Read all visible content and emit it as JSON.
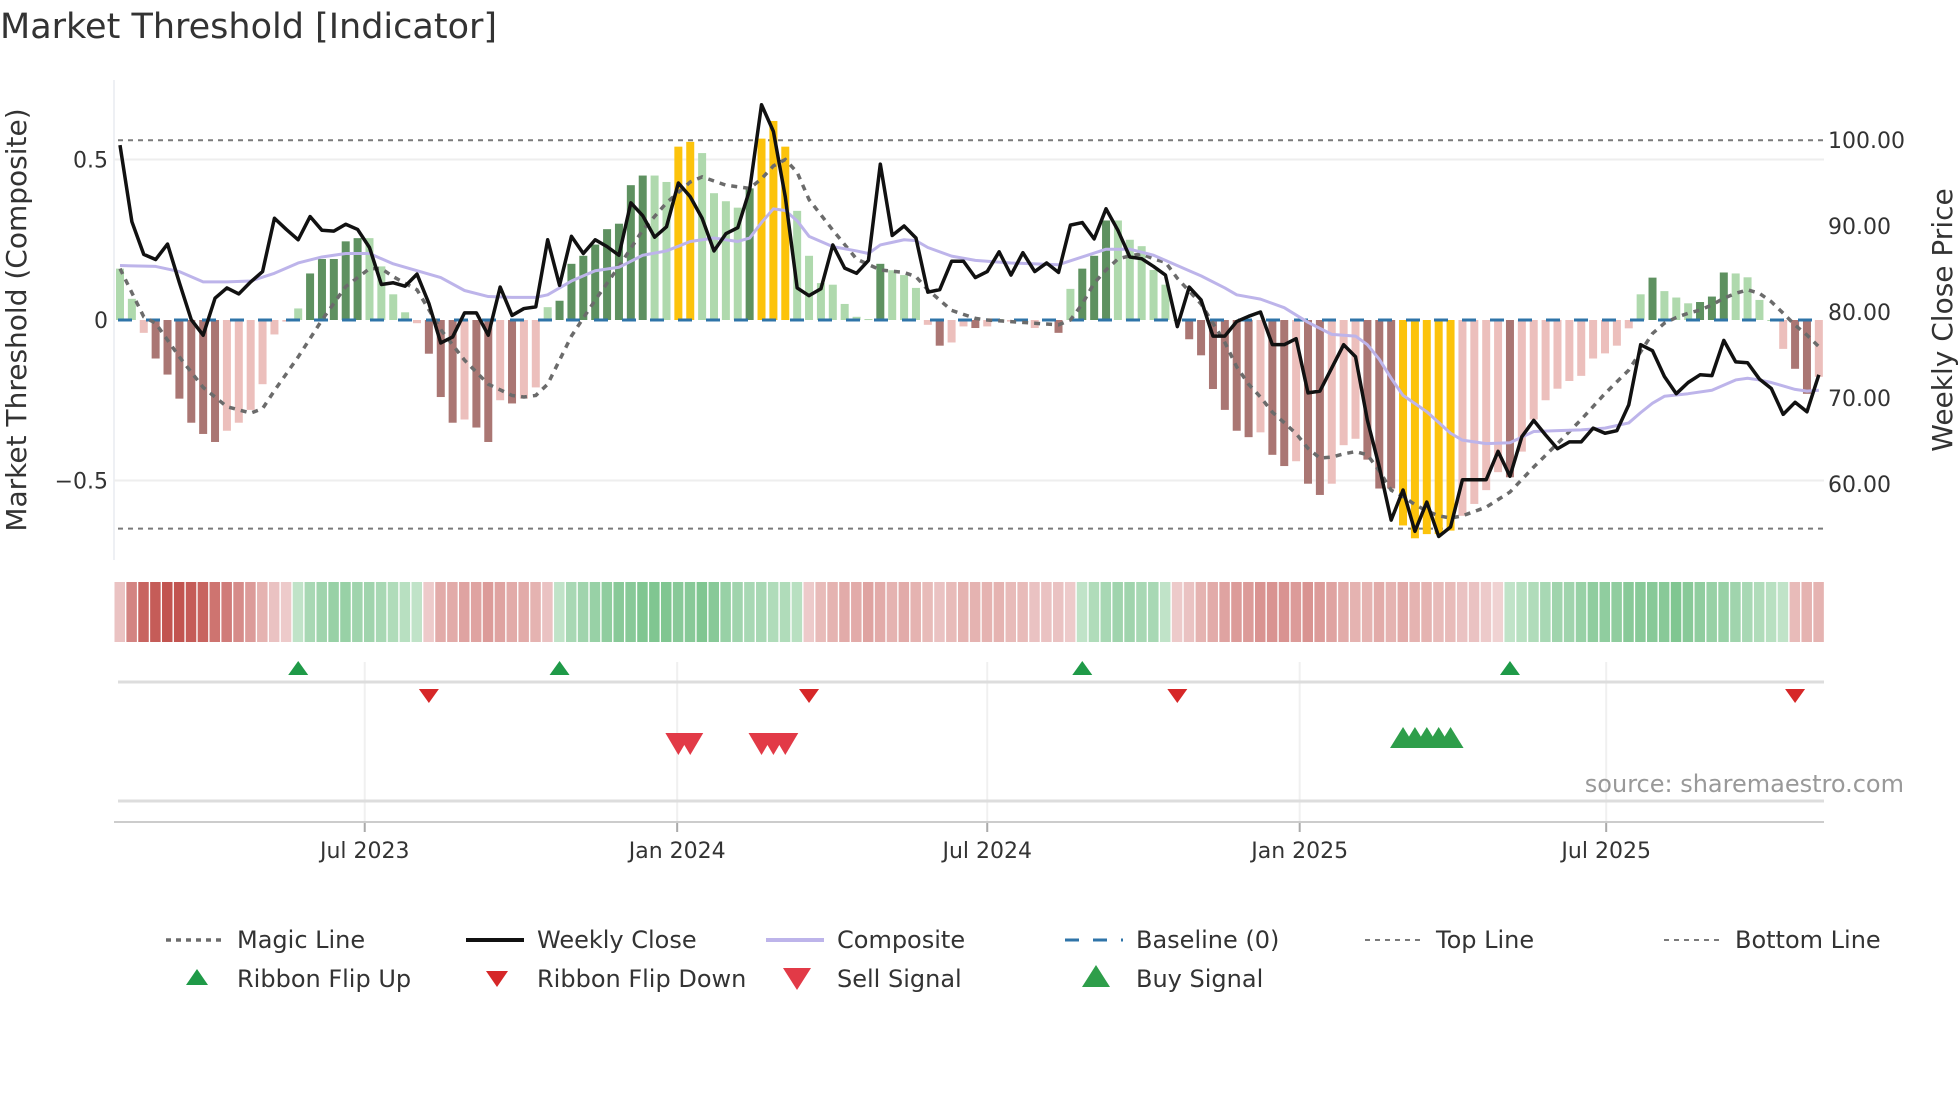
{
  "title": "Market Threshold [Indicator]",
  "source": "source: sharemaestro.com",
  "colors": {
    "bar_pos_dark": "#5e9160",
    "bar_pos_light": "#afd9ad",
    "bar_neg_dark": "#aa7673",
    "bar_neg_light": "#ecbfbc",
    "bar_signal": "#fcc30b",
    "weekly_close": "#111111",
    "composite": "#bdb4ea",
    "magic": "#6b6b6b",
    "baseline": "#2f74a8",
    "threshold": "#7a7a7a",
    "flip_up": "#1f9a48",
    "flip_down": "#d62728",
    "sell": "#e23a47",
    "buy": "#2e9e4a"
  },
  "chart_data": {
    "type": "bar+line",
    "title": "Market Threshold [Indicator]",
    "ylabel_left": "Market Threshold (Composite)",
    "ylabel_right": "Weekly Close Price",
    "ylim_left": [
      -0.75,
      0.7
    ],
    "ylim_right": [
      54,
      104
    ],
    "left_ticks": [
      {
        "label": "0.5",
        "value": 0.5
      },
      {
        "label": "0",
        "value": 0
      },
      {
        "label": "−0.5",
        "value": -0.5
      }
    ],
    "right_ticks": [
      {
        "label": "100.00",
        "value": 100
      },
      {
        "label": "90.00",
        "value": 90
      },
      {
        "label": "80.00",
        "value": 80
      },
      {
        "label": "70.00",
        "value": 70
      },
      {
        "label": "60.00",
        "value": 60
      }
    ],
    "x_ticks": [
      {
        "label": "Jul 2023",
        "week_index": 20.6
      },
      {
        "label": "Jan 2024",
        "week_index": 46.9
      },
      {
        "label": "Jul 2024",
        "week_index": 73
      },
      {
        "label": "Jan 2025",
        "week_index": 99.3
      },
      {
        "label": "Jul 2025",
        "week_index": 125.1
      }
    ],
    "top_line": 0.56,
    "bottom_line": -0.65,
    "baseline": 0,
    "composite_bars": [
      0.16,
      0.066,
      -0.04,
      -0.12,
      -0.17,
      -0.245,
      -0.32,
      -0.355,
      -0.38,
      -0.345,
      -0.32,
      -0.28,
      -0.2,
      -0.045,
      -0.005,
      0.036,
      0.145,
      0.19,
      0.19,
      0.245,
      0.255,
      0.255,
      0.167,
      0.08,
      0.024,
      -0.01,
      -0.105,
      -0.24,
      -0.32,
      -0.31,
      -0.335,
      -0.38,
      -0.25,
      -0.26,
      -0.245,
      -0.21,
      0.04,
      0.06,
      0.175,
      0.2,
      0.235,
      0.283,
      0.3,
      0.42,
      0.45,
      0.45,
      0.43,
      0.54,
      0.555,
      0.52,
      0.395,
      0.37,
      0.35,
      0.41,
      0.565,
      0.62,
      0.54,
      0.34,
      0.2,
      0.115,
      0.11,
      0.05,
      0.01,
      0.003,
      0.175,
      0.155,
      0.14,
      0.1,
      -0.015,
      -0.08,
      -0.07,
      -0.02,
      -0.025,
      -0.02,
      0.003,
      -0.005,
      0,
      -0.025,
      0,
      -0.04,
      0.097,
      0.16,
      0.2,
      0.31,
      0.31,
      0.25,
      0.23,
      0.156,
      0.11,
      0,
      -0.06,
      -0.11,
      -0.215,
      -0.28,
      -0.345,
      -0.365,
      -0.35,
      -0.42,
      -0.455,
      -0.44,
      -0.51,
      -0.545,
      -0.51,
      -0.39,
      -0.37,
      -0.435,
      -0.525,
      -0.525,
      -0.64,
      -0.68,
      -0.667,
      -0.667,
      -0.656,
      -0.61,
      -0.573,
      -0.53,
      -0.474,
      -0.49,
      -0.41,
      -0.31,
      -0.25,
      -0.214,
      -0.19,
      -0.174,
      -0.12,
      -0.104,
      -0.08,
      -0.026,
      0.08,
      0.132,
      0.09,
      0.07,
      0.052,
      0.056,
      0.073,
      0.148,
      0.145,
      0.133,
      0.0625,
      0,
      -0.09,
      -0.152,
      -0.23,
      -0.177
    ],
    "bar_shades": "LLLDDDDDDLLLLLLLDDDDDLLLLLDDDLDDLDLLLDDDDDDDDLLYYLLLLDYYYLLLLLLLDLLLLDLLDLLLLLLDLDDDLLLLLLDDDDDDLDDLDDLLLDDDYYYYYLLLLDLLLLLLLLLLLDLLLDDDLLLLLDDL",
    "weekly_close": [
      99.4,
      90.5,
      86.7,
      86.1,
      87.9,
      83.4,
      79.1,
      77.3,
      81.6,
      82.8,
      82.1,
      83.5,
      84.7,
      90.9,
      89.6,
      88.4,
      91.1,
      89.5,
      89.4,
      90.2,
      89.6,
      87.5,
      83.2,
      83.4,
      83.0,
      84.4,
      81.0,
      76.4,
      77.1,
      79.9,
      79.9,
      77.3,
      82.9,
      79.6,
      80.4,
      80.6,
      88.4,
      83.1,
      88.8,
      86.8,
      88.4,
      87.6,
      86.6,
      92.7,
      91.2,
      88.7,
      89.9,
      95.0,
      93.4,
      90.9,
      87.1,
      89.1,
      89.8,
      94.2,
      104.1,
      101.0,
      93.4,
      82.8,
      81.9,
      82.7,
      87.8,
      85.1,
      84.5,
      86.0,
      97.2,
      88.9,
      90.0,
      88.6,
      82.3,
      82.6,
      85.9,
      85.9,
      84.0,
      84.7,
      87.0,
      84.3,
      86.9,
      84.7,
      85.7,
      84.6,
      90.1,
      90.4,
      88.5,
      92.0,
      89.5,
      86.4,
      86.2,
      85.3,
      84.3,
      78.3,
      82.9,
      81.4,
      77.2,
      77.2,
      78.9,
      79.5,
      80.0,
      76.2,
      76.2,
      76.9,
      70.6,
      70.8,
      73.5,
      76.2,
      74.8,
      67.4,
      62.0,
      55.8,
      59.3,
      54.5,
      57.9,
      53.9,
      55.0,
      60.5,
      60.5,
      60.5,
      63.8,
      60.9,
      65.5,
      67.4,
      65.7,
      64.1,
      64.9,
      64.9,
      66.5,
      65.9,
      66.2,
      69.2,
      76.2,
      75.5,
      72.5,
      70.5,
      71.8,
      72.7,
      72.6,
      76.7,
      74.2,
      74.1,
      72.2,
      71.1,
      68.1,
      69.5,
      68.4,
      72.7
    ],
    "composite_line": [
      [
        0,
        85.4
      ],
      [
        3,
        85.3
      ],
      [
        5,
        84.7
      ],
      [
        7,
        83.5
      ],
      [
        9,
        83.5
      ],
      [
        11,
        83.6
      ],
      [
        13,
        84.5
      ],
      [
        15,
        85.7
      ],
      [
        17,
        86.4
      ],
      [
        19,
        86.8
      ],
      [
        21,
        86.8
      ],
      [
        23,
        85.6
      ],
      [
        25,
        84.8
      ],
      [
        27,
        84.0
      ],
      [
        29,
        82.5
      ],
      [
        31,
        81.8
      ],
      [
        33,
        81.7
      ],
      [
        35,
        81.7
      ],
      [
        36,
        82.0
      ],
      [
        38,
        83.6
      ],
      [
        40,
        84.8
      ],
      [
        42,
        85.2
      ],
      [
        44,
        86.6
      ],
      [
        46,
        87.1
      ],
      [
        48,
        88.2
      ],
      [
        50,
        88.6
      ],
      [
        52,
        88.2
      ],
      [
        53,
        88.6
      ],
      [
        54,
        90.4
      ],
      [
        55,
        92.0
      ],
      [
        56,
        91.8
      ],
      [
        57,
        90.6
      ],
      [
        58,
        88.8
      ],
      [
        60,
        87.6
      ],
      [
        62,
        87.1
      ],
      [
        63,
        86.8
      ],
      [
        64,
        87.8
      ],
      [
        66,
        88.4
      ],
      [
        67,
        88.3
      ],
      [
        68,
        87.5
      ],
      [
        70,
        86.5
      ],
      [
        72,
        86.0
      ],
      [
        75,
        85.7
      ],
      [
        79,
        85.5
      ],
      [
        81,
        86.4
      ],
      [
        83,
        87.3
      ],
      [
        85,
        87.3
      ],
      [
        87,
        86.6
      ],
      [
        88,
        86.0
      ],
      [
        90,
        84.8
      ],
      [
        91,
        84.2
      ],
      [
        93,
        82.8
      ],
      [
        94,
        82.0
      ],
      [
        96,
        81.5
      ],
      [
        98,
        80.5
      ],
      [
        100,
        78.8
      ],
      [
        102,
        77.4
      ],
      [
        104,
        77.2
      ],
      [
        105,
        76.2
      ],
      [
        106,
        74.5
      ],
      [
        107,
        72.3
      ],
      [
        108,
        70.3
      ],
      [
        110,
        68.4
      ],
      [
        112,
        65.9
      ],
      [
        113,
        65.1
      ],
      [
        115,
        64.7
      ],
      [
        117,
        64.8
      ],
      [
        119,
        66.1
      ],
      [
        121,
        66.2
      ],
      [
        123,
        66.3
      ],
      [
        125,
        66.5
      ],
      [
        127,
        67.1
      ],
      [
        128,
        68.3
      ],
      [
        129,
        69.4
      ],
      [
        130,
        70.2
      ],
      [
        132,
        70.5
      ],
      [
        134,
        70.9
      ],
      [
        135,
        71.5
      ],
      [
        136,
        72.1
      ],
      [
        137,
        72.3
      ],
      [
        138,
        72.1
      ],
      [
        139,
        71.8
      ],
      [
        140,
        71.4
      ],
      [
        141,
        71.0
      ],
      [
        142,
        70.8
      ],
      [
        143,
        70.9
      ]
    ],
    "magic_line": [
      [
        0,
        0.16
      ],
      [
        2,
        0.01
      ],
      [
        3,
        -0.01
      ],
      [
        5,
        -0.115
      ],
      [
        7,
        -0.21
      ],
      [
        9,
        -0.27
      ],
      [
        11,
        -0.29
      ],
      [
        12,
        -0.276
      ],
      [
        13,
        -0.22
      ],
      [
        15,
        -0.115
      ],
      [
        17,
        0
      ],
      [
        19,
        0.104
      ],
      [
        21,
        0.16
      ],
      [
        22,
        0.16
      ],
      [
        23,
        0.135
      ],
      [
        25,
        0.094
      ],
      [
        27,
        -0.03
      ],
      [
        29,
        -0.125
      ],
      [
        31,
        -0.2
      ],
      [
        33,
        -0.235
      ],
      [
        34,
        -0.24
      ],
      [
        35,
        -0.235
      ],
      [
        36,
        -0.2
      ],
      [
        38,
        -0.05
      ],
      [
        40,
        0.062
      ],
      [
        42,
        0.167
      ],
      [
        44,
        0.28
      ],
      [
        46,
        0.365
      ],
      [
        48,
        0.43
      ],
      [
        49,
        0.446
      ],
      [
        51,
        0.42
      ],
      [
        53,
        0.41
      ],
      [
        54,
        0.44
      ],
      [
        55,
        0.48
      ],
      [
        56,
        0.5
      ],
      [
        57,
        0.46
      ],
      [
        58,
        0.375
      ],
      [
        60,
        0.28
      ],
      [
        62,
        0.19
      ],
      [
        64,
        0.156
      ],
      [
        66,
        0.148
      ],
      [
        67,
        0.135
      ],
      [
        68,
        0.094
      ],
      [
        70,
        0.03
      ],
      [
        72,
        0.005
      ],
      [
        73,
        0
      ],
      [
        75,
        -0.005
      ],
      [
        77,
        -0.01
      ],
      [
        79,
        -0.015
      ],
      [
        80,
        0
      ],
      [
        81,
        0.05
      ],
      [
        82,
        0.115
      ],
      [
        83,
        0.156
      ],
      [
        84,
        0.19
      ],
      [
        85,
        0.2
      ],
      [
        86,
        0.206
      ],
      [
        87,
        0.19
      ],
      [
        88,
        0.18
      ],
      [
        89,
        0.13
      ],
      [
        90,
        0.09
      ],
      [
        91,
        0.05
      ],
      [
        92,
        -0.01
      ],
      [
        93,
        -0.07
      ],
      [
        94,
        -0.146
      ],
      [
        95,
        -0.2
      ],
      [
        96,
        -0.24
      ],
      [
        97,
        -0.287
      ],
      [
        98,
        -0.32
      ],
      [
        99,
        -0.354
      ],
      [
        100,
        -0.4
      ],
      [
        101,
        -0.43
      ],
      [
        102,
        -0.427
      ],
      [
        103,
        -0.417
      ],
      [
        104,
        -0.41
      ],
      [
        105,
        -0.42
      ],
      [
        106,
        -0.47
      ],
      [
        107,
        -0.53
      ],
      [
        108,
        -0.55
      ],
      [
        109,
        -0.575
      ],
      [
        110,
        -0.595
      ],
      [
        111,
        -0.61
      ],
      [
        112,
        -0.617
      ],
      [
        113,
        -0.61
      ],
      [
        115,
        -0.583
      ],
      [
        117,
        -0.536
      ],
      [
        119,
        -0.458
      ],
      [
        121,
        -0.385
      ],
      [
        123,
        -0.31
      ],
      [
        125,
        -0.229
      ],
      [
        127,
        -0.156
      ],
      [
        129,
        -0.042
      ],
      [
        130,
        -0.01
      ],
      [
        131,
        0.008
      ],
      [
        132,
        0.021
      ],
      [
        133,
        0.031
      ],
      [
        134,
        0.047
      ],
      [
        135,
        0.068
      ],
      [
        136,
        0.083
      ],
      [
        137,
        0.094
      ],
      [
        138,
        0.083
      ],
      [
        139,
        0.057
      ],
      [
        140,
        0.021
      ],
      [
        141,
        -0.016
      ],
      [
        142,
        -0.047
      ],
      [
        143,
        -0.083
      ]
    ],
    "ribbon": [
      -0.2,
      -0.6,
      -0.8,
      -0.85,
      -0.9,
      -0.9,
      -0.85,
      -0.8,
      -0.7,
      -0.65,
      -0.55,
      -0.45,
      -0.3,
      -0.2,
      -0.15,
      0.2,
      0.35,
      0.4,
      0.45,
      0.45,
      0.4,
      0.4,
      0.35,
      0.3,
      0.25,
      0.2,
      -0.15,
      -0.35,
      -0.35,
      -0.4,
      -0.4,
      -0.45,
      -0.4,
      -0.35,
      -0.35,
      -0.3,
      -0.2,
      0.2,
      0.35,
      0.4,
      0.45,
      0.5,
      0.55,
      0.55,
      0.6,
      0.6,
      0.6,
      0.55,
      0.55,
      0.6,
      0.55,
      0.45,
      0.4,
      0.35,
      0.35,
      0.3,
      0.3,
      0.25,
      -0.15,
      -0.25,
      -0.3,
      -0.35,
      -0.35,
      -0.4,
      -0.35,
      -0.3,
      -0.35,
      -0.3,
      -0.25,
      -0.2,
      -0.25,
      -0.3,
      -0.3,
      -0.3,
      -0.3,
      -0.25,
      -0.25,
      -0.2,
      -0.2,
      -0.2,
      -0.15,
      0.2,
      0.3,
      0.35,
      0.4,
      0.4,
      0.35,
      0.35,
      0.2,
      -0.15,
      -0.2,
      -0.3,
      -0.35,
      -0.4,
      -0.45,
      -0.45,
      -0.5,
      -0.5,
      -0.5,
      -0.45,
      -0.5,
      -0.45,
      -0.4,
      -0.35,
      -0.3,
      -0.3,
      -0.35,
      -0.3,
      -0.35,
      -0.3,
      -0.3,
      -0.25,
      -0.25,
      -0.2,
      -0.2,
      -0.15,
      -0.1,
      0.2,
      0.25,
      0.3,
      0.35,
      0.4,
      0.4,
      0.45,
      0.5,
      0.5,
      0.5,
      0.55,
      0.55,
      0.55,
      0.55,
      0.6,
      0.55,
      0.5,
      0.45,
      0.45,
      0.4,
      0.35,
      0.3,
      0.25,
      0.2,
      -0.25,
      -0.3,
      -0.3
    ],
    "ribbon_flip_up": [
      15,
      37,
      81,
      117
    ],
    "ribbon_flip_down": [
      26,
      58,
      89,
      141
    ],
    "sell_signals": [
      47,
      48,
      54,
      55,
      56
    ],
    "buy_signals": [
      108,
      109,
      110,
      111,
      112
    ],
    "legend": [
      {
        "label": "Magic Line",
        "symbol": "dotted-line",
        "color_key": "magic"
      },
      {
        "label": "Weekly Close",
        "symbol": "solid-line",
        "color_key": "weekly_close"
      },
      {
        "label": "Composite",
        "symbol": "solid-line",
        "color_key": "composite"
      },
      {
        "label": "Baseline (0)",
        "symbol": "dashed-line",
        "color_key": "baseline"
      },
      {
        "label": "Top Line",
        "symbol": "dotted-thin",
        "color_key": "threshold"
      },
      {
        "label": "Bottom Line",
        "symbol": "dotted-thin",
        "color_key": "threshold"
      },
      {
        "label": "Ribbon Flip Up",
        "symbol": "triangle-up",
        "color_key": "flip_up"
      },
      {
        "label": "Ribbon Flip Down",
        "symbol": "triangle-down",
        "color_key": "flip_down"
      },
      {
        "label": "Sell Signal",
        "symbol": "triangle-down-large",
        "color_key": "sell"
      },
      {
        "label": "Buy Signal",
        "symbol": "triangle-up-large",
        "color_key": "buy"
      }
    ]
  }
}
